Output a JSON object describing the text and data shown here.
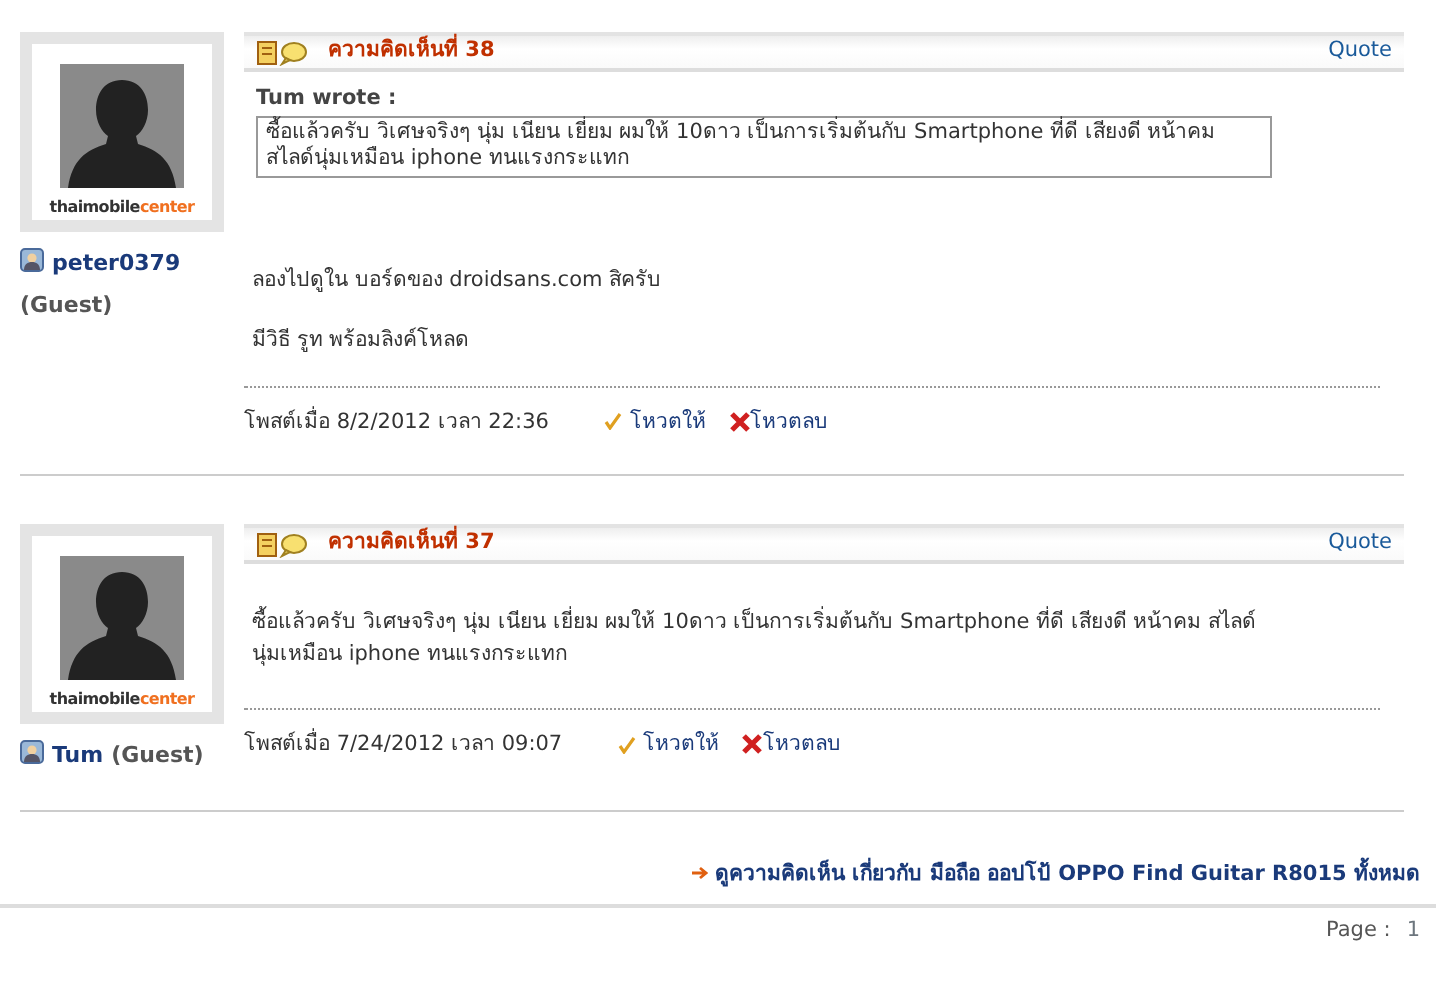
{
  "posts": [
    {
      "title": "ความคิดเห็นที่ 38",
      "quote_link": "Quote",
      "brand": [
        "thaimobile",
        "center"
      ],
      "author": "peter0379",
      "role": "(Guest)",
      "quote": {
        "by": "Tum wrote :",
        "text": "ซื้อแล้วครับ วิเศษจริงๆ นุ่ม เนียน เยี่ยม ผมให้ 10ดาว เป็นการเริ่มต้นกับ Smartphone ที่ดี เสียงดี หน้าคม สไลด์นุ่มเหมือน iphone ทนแรงกระแทก"
      },
      "paragraphs": [
        "ลองไปดูใน บอร์ดของ droidsans.com สิครับ",
        "มีวิธี รูท พร้อมลิงค์โหลด"
      ],
      "posted": "โพสต์เมื่อ 8/2/2012  เวลา 22:36",
      "vote_up": "โหวตให้",
      "vote_down": "โหวตลบ"
    },
    {
      "title": "ความคิดเห็นที่ 37",
      "quote_link": "Quote",
      "brand": [
        "thaimobile",
        "center"
      ],
      "author": "Tum",
      "role": "(Guest)",
      "paragraphs": [
        "ซื้อแล้วครับ วิเศษจริงๆ นุ่ม เนียน เยี่ยม ผมให้ 10ดาว เป็นการเริ่มต้นกับ Smartphone ที่ดี เสียงดี หน้าคม สไลด์นุ่มเหมือน iphone ทนแรงกระแทก"
      ],
      "posted": "โพสต์เมื่อ 7/24/2012  เวลา 09:07",
      "vote_up": "โหวตให้",
      "vote_down": "โหวตลบ"
    }
  ],
  "footer_link": "ดูความคิดเห็น เกี่ยวกับ มือถือ ออปโป้ OPPO Find Guitar R8015 ทั้งหมด",
  "pagination": {
    "label": "Page :",
    "pages": [
      "1"
    ]
  }
}
